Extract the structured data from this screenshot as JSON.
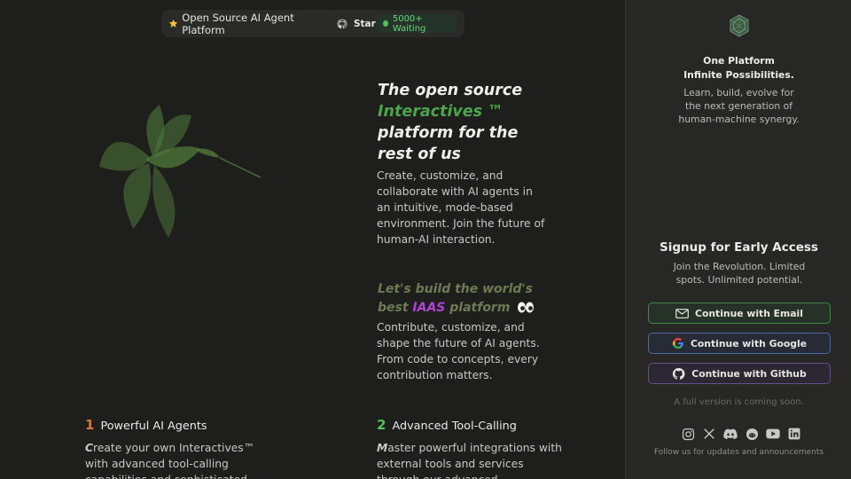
{
  "header": {
    "tag_label": "Open Source AI Agent Platform",
    "star_label": "Star",
    "waiting_label": "5000+ Waiting",
    "accent_green": "#4fc35d"
  },
  "hero": {
    "title_line1": "The open source",
    "title_highlight": "Interactives ™",
    "title_line3": "platform for the",
    "title_line4": "rest of us",
    "description": "Create, customize, and collaborate with AI agents in an intuitive, mode-based environment. Join the future of human-AI interaction."
  },
  "build": {
    "title_part1": "Let's build the world's best",
    "title_highlight": "IAAS",
    "title_part2": "platform",
    "highlight_color": "#b142d6",
    "description": "Contribute, customize, and shape the future of AI agents. From code to concepts, every contribution matters."
  },
  "features": [
    {
      "number": "1",
      "title": "Powerful AI Agents",
      "desc_first": "C",
      "desc_rest": "reate your own Interactives™ with advanced tool-calling capabilities and sophisticated",
      "color": "#d3783a"
    },
    {
      "number": "2",
      "title": "Advanced Tool-Calling",
      "desc_first": "M",
      "desc_rest": "aster powerful integrations with external tools and services through our advanced",
      "color": "#4fc35d"
    }
  ],
  "panel": {
    "tagline_line1": "One Platform",
    "tagline_line2": "Infinite Possibilities.",
    "tagline_sub": "Learn, build, evolve for the next generation of human-machine synergy.",
    "signup_title": "Signup for Early Access",
    "signup_sub": "Join the Revolution. Limited spots. Unlimited potential.",
    "buttons": {
      "email": "Continue with Email",
      "google": "Continue with Google",
      "github": "Continue with Github"
    },
    "coming_soon": "A full version is coming soon.",
    "socials": [
      "instagram-icon",
      "x-icon",
      "discord-icon",
      "reddit-icon",
      "youtube-icon",
      "linkedin-icon"
    ],
    "follow_text": "Follow us for updates and announcements"
  }
}
